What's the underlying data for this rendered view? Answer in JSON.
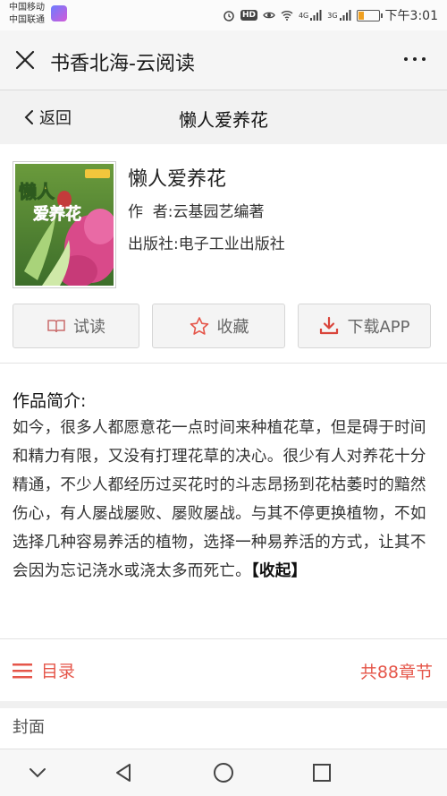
{
  "status_bar": {
    "carrier1": "中国移动",
    "carrier2": "中国联通",
    "signal1": "4G",
    "signal2": "3G",
    "time": "下午3:01"
  },
  "appbar": {
    "title": "书香北海-云阅读"
  },
  "page_header": {
    "back_label": "返回",
    "title": "懒人爱养花"
  },
  "book": {
    "title": "懒人爱养花",
    "author": "作  者:云基园艺编著",
    "publisher": "出版社:电子工业出版社",
    "cover": {
      "title_line1": "懒人",
      "title_line2": "爱养花"
    }
  },
  "actions": {
    "read_label": "试读",
    "favorite_label": "收藏",
    "download_label": "下载APP"
  },
  "intro": {
    "label": "作品简介:",
    "text": "如今，很多人都愿意花一点时间来种植花草，但是碍于时间和精力有限，又没有打理花草的决心。很少有人对养花十分精通，不少人都经历过买花时的斗志昂扬到花枯萎时的黯然伤心，有人屡战屡败、屡败屡战。与其不停更换植物，不如选择几种容易养活的植物，选择一种易养活的方式，让其不会因为忘记浇水或浇太多而死亡。",
    "collapse_label": "【收起】"
  },
  "toc": {
    "label": "目录",
    "count": "共88章节"
  },
  "cover_section": {
    "label": "封面"
  },
  "colors": {
    "accent": "#e5564a",
    "download_icon": "#d9443a",
    "read_icon": "#c96b6b"
  }
}
